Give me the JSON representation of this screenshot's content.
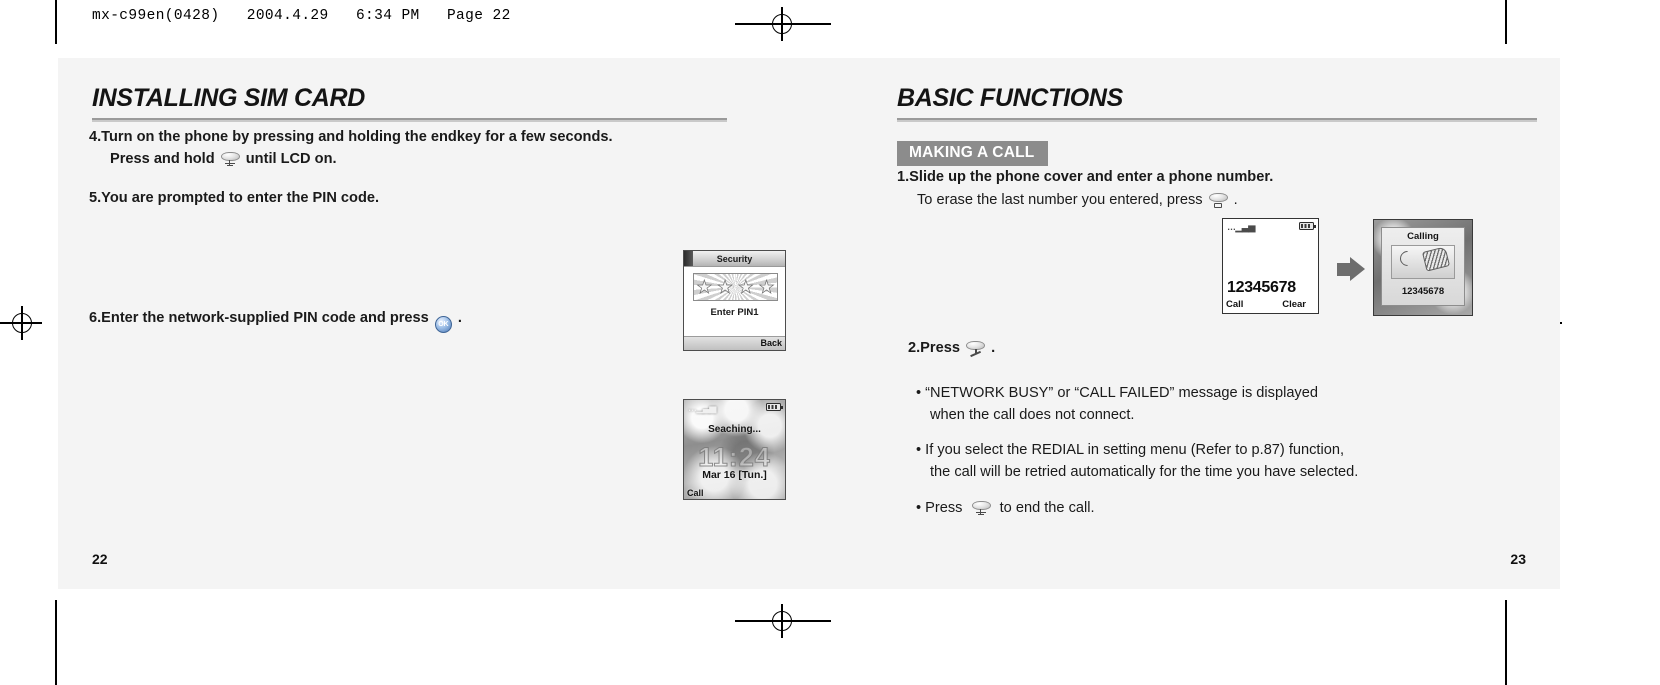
{
  "scan_header": "mx-c99en(0428)   2004.4.29   6:34 PM   Page 22",
  "left_page": {
    "section_title": "INSTALLING SIM CARD",
    "page_number": "22",
    "steps": [
      {
        "text": "4.Turn on the phone by pressing and holding the endkey for a few seconds."
      },
      {
        "pre": "Press and hold",
        "icon": "end-key-icon",
        "post": "until LCD on."
      },
      {
        "text": "5.You are prompted to enter the PIN code."
      },
      {
        "pre": "6.Enter the network-supplied PIN code and press",
        "icon": "ok-key-icon",
        "post": "."
      }
    ],
    "security_screen": {
      "title": "Security",
      "stars": "★★★★",
      "prompt": "Enter PIN1",
      "softkey_right": "Back"
    },
    "searching_screen": {
      "signal": "signal-icon",
      "battery": "battery-icon",
      "status": "Seaching...",
      "clock": "11:24",
      "date": "Mar 16 [Tun.]",
      "softkey_left": "Call"
    }
  },
  "right_page": {
    "section_title": "BASIC FUNCTIONS",
    "page_number": "23",
    "subsection": "MAKING A CALL",
    "steps": [
      {
        "text": "1.Slide up the phone cover and enter a phone number."
      },
      {
        "pre": "To erase the last number you entered, press",
        "icon": "clear-key-icon",
        "post": "."
      },
      {
        "pre": "2.Press",
        "icon": "send-key-icon",
        "post": "."
      }
    ],
    "bullets": [
      {
        "line1": "“NETWORK BUSY” or “CALL FAILED” message is displayed",
        "line2": "when the call does not connect."
      },
      {
        "line1": "If you select the REDIAL in setting menu (Refer to p.87) function,",
        "line2": "the call will be retried automatically for the time you have selected."
      },
      {
        "pre": "Press",
        "icon": "end-key-icon",
        "post": "to end the call.",
        "line1": "",
        "line2": ""
      }
    ],
    "dial_screen": {
      "signal": "signal-icon",
      "battery": "battery-icon",
      "number": "12345678",
      "softkey_left": "Call",
      "softkey_right": "Clear"
    },
    "calling_screen": {
      "title": "Calling",
      "number": "12345678"
    },
    "transition_icon": "arrow-right-icon"
  },
  "colors": {
    "page_background": "#f4f4f4",
    "rule_gray": "#9a9a9a",
    "subbar_gray": "#8c8c8c",
    "text_black": "#1a1a1a",
    "ok_key_blue": "#4a77b4"
  }
}
